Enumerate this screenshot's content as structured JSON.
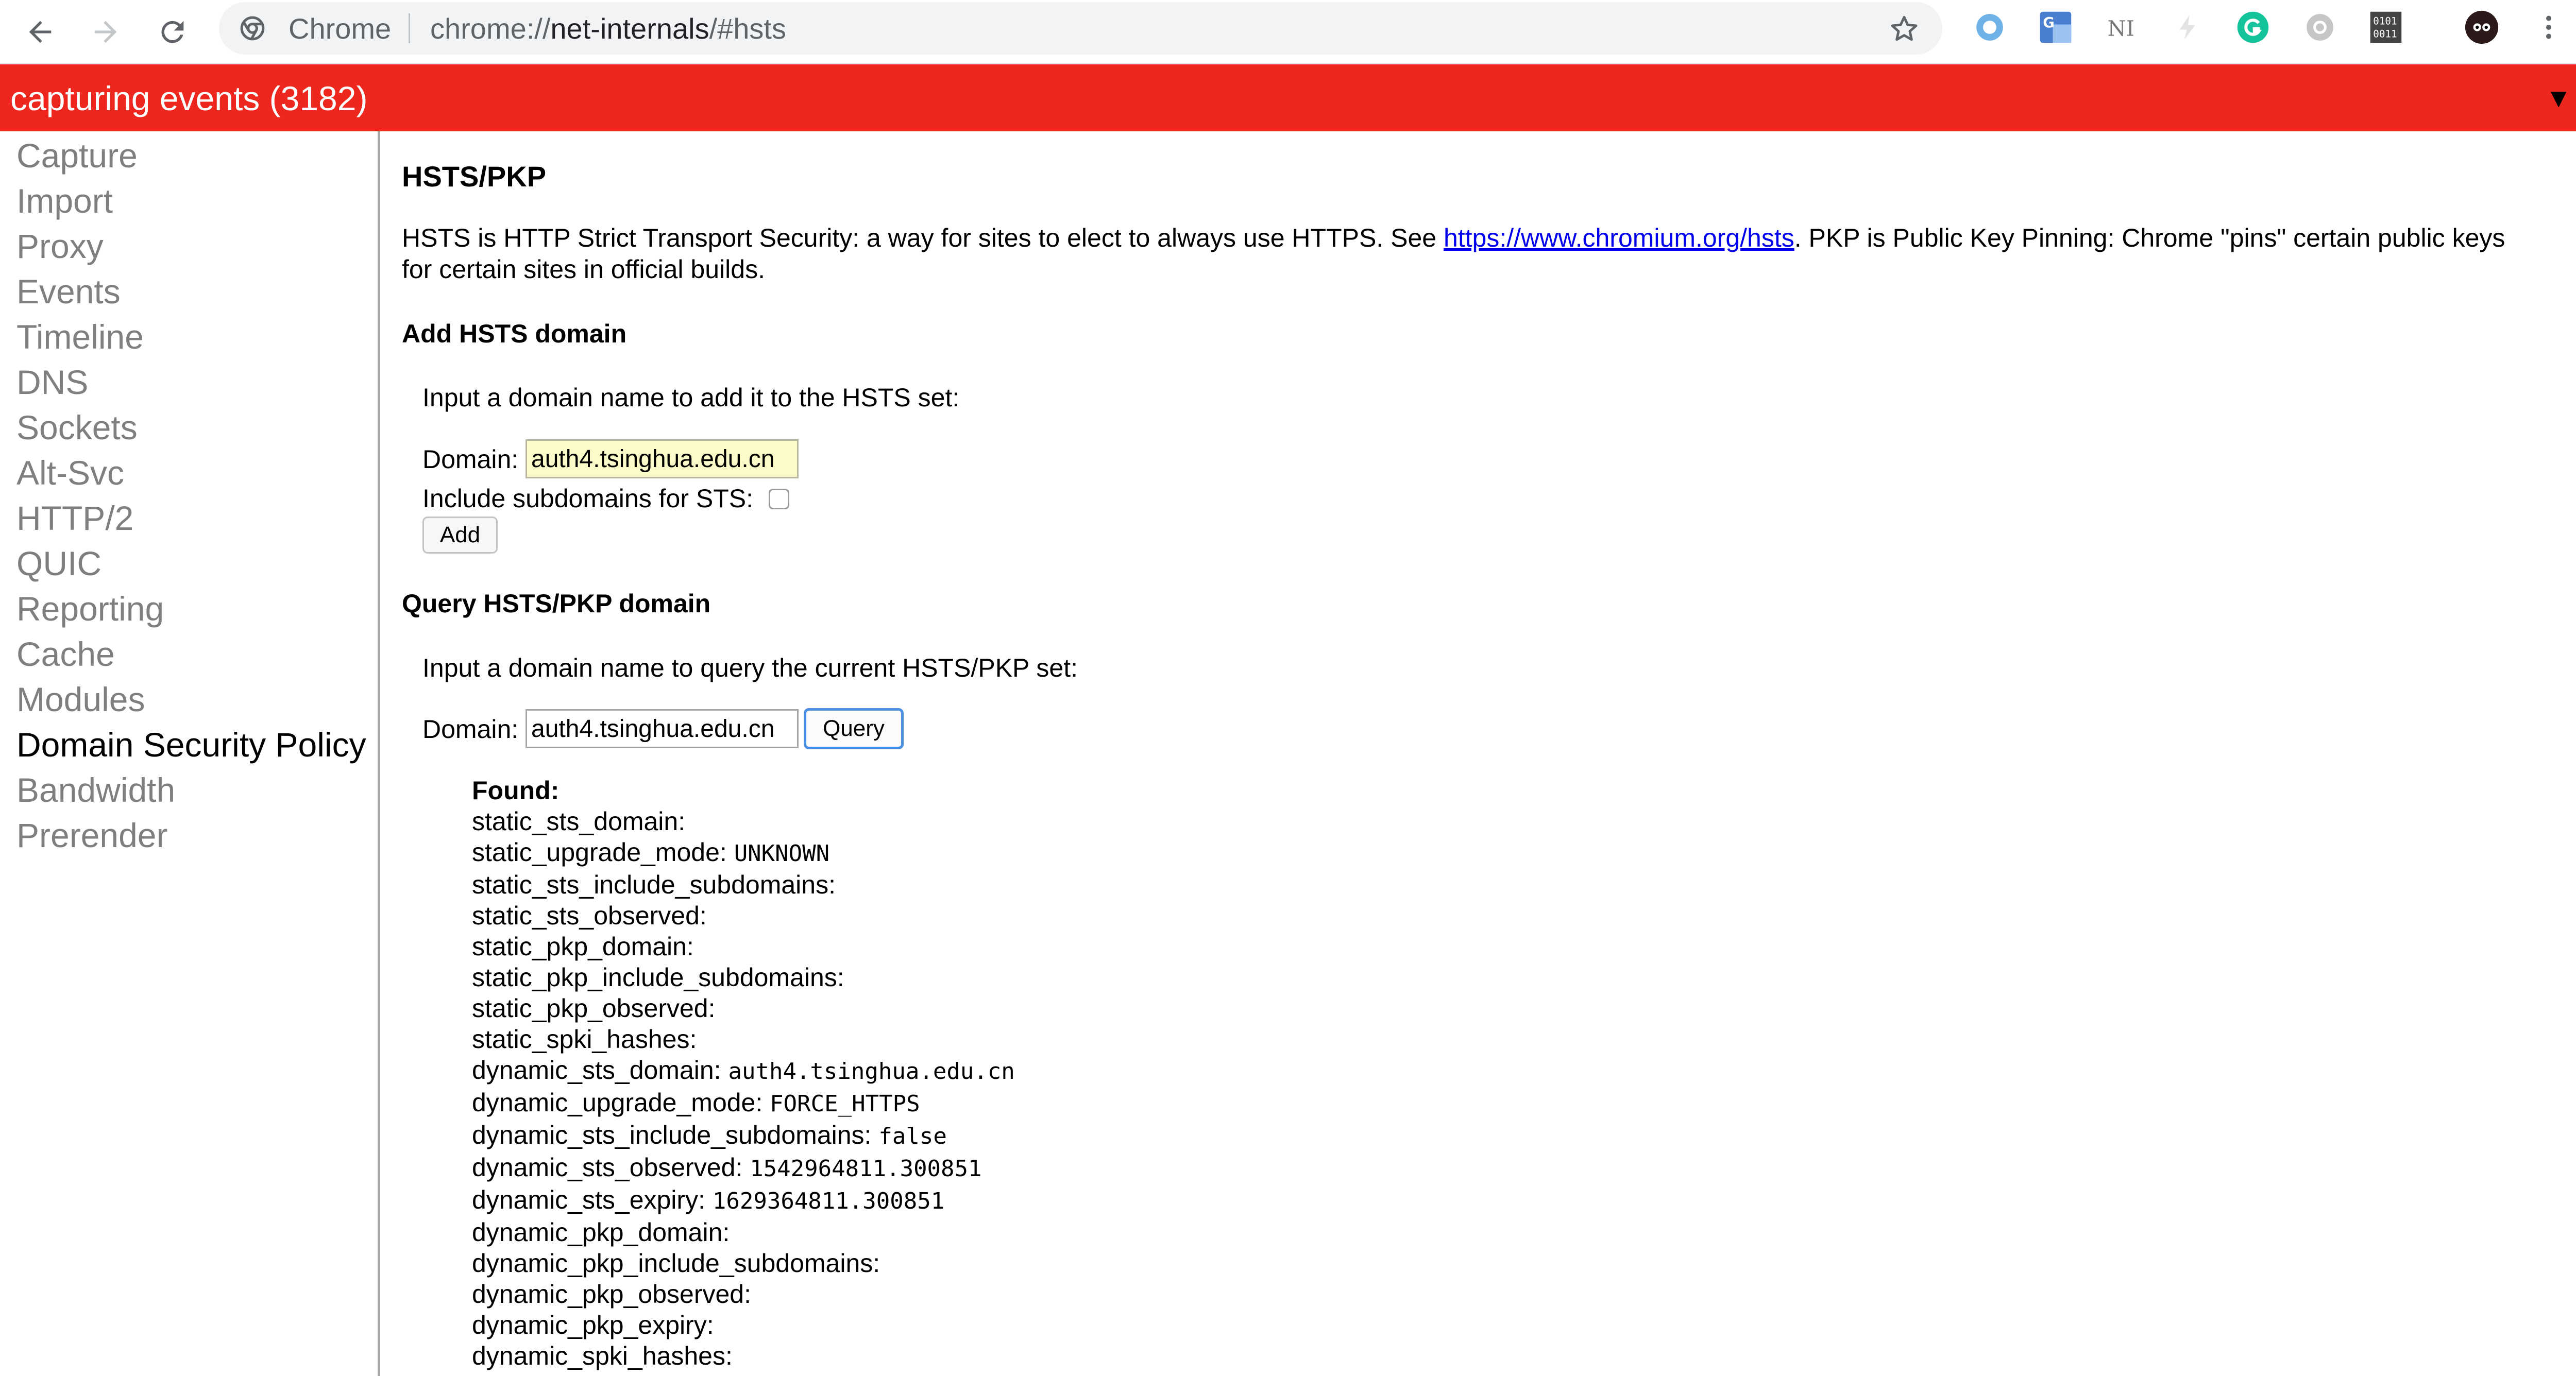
{
  "browser": {
    "back_icon": "arrow-left-icon",
    "forward_icon": "arrow-right-icon",
    "reload_icon": "reload-icon",
    "site_label": "Chrome",
    "url_scheme": "chrome://",
    "url_host": "net-internals",
    "url_path": "/#hsts",
    "bookmark_icon": "star-icon",
    "extensions": [
      "circle-extension-icon",
      "translate-extension-icon",
      "ni-extension-icon",
      "bolt-extension-icon",
      "grammarly-extension-icon",
      "gear-extension-icon",
      "binary-extension-icon",
      "avatar-icon",
      "menu-dots-icon"
    ],
    "ext_binary_text": "0101 0011",
    "ext_ni_text": "NI"
  },
  "capture_bar": {
    "text": "capturing events (3182)",
    "arrow": "▼",
    "color": "#ed271e"
  },
  "sidebar": {
    "items": [
      {
        "label": "Capture"
      },
      {
        "label": "Import"
      },
      {
        "label": "Proxy"
      },
      {
        "label": "Events"
      },
      {
        "label": "Timeline"
      },
      {
        "label": "DNS"
      },
      {
        "label": "Sockets"
      },
      {
        "label": "Alt-Svc"
      },
      {
        "label": "HTTP/2"
      },
      {
        "label": "QUIC"
      },
      {
        "label": "Reporting"
      },
      {
        "label": "Cache"
      },
      {
        "label": "Modules"
      },
      {
        "label": "Domain Security Policy",
        "active": true
      },
      {
        "label": "Bandwidth"
      },
      {
        "label": "Prerender"
      }
    ]
  },
  "main": {
    "title": "HSTS/PKP",
    "desc_part1": "HSTS is HTTP Strict Transport Security: a way for sites to elect to always use HTTPS. See ",
    "desc_link": "https://www.chromium.org/hsts",
    "desc_part2": ". PKP is Public Key Pinning: Chrome \"pins\" certain public keys",
    "desc_line2": "for certain sites in official builds.",
    "add": {
      "heading": "Add HSTS domain",
      "instruction": "Input a domain name to add it to the HSTS set:",
      "domain_label": "Domain:",
      "domain_value": "auth4.tsinghua.edu.cn",
      "subdomains_label": "Include subdomains for STS:",
      "subdomains_checked": false,
      "button": "Add"
    },
    "query": {
      "heading": "Query HSTS/PKP domain",
      "instruction": "Input a domain name to query the current HSTS/PKP set:",
      "domain_label": "Domain:",
      "domain_value": "auth4.tsinghua.edu.cn",
      "button": "Query"
    },
    "result": {
      "found_label": "Found:",
      "fields": [
        {
          "key": "static_sts_domain:",
          "value": ""
        },
        {
          "key": "static_upgrade_mode:",
          "value": "UNKNOWN"
        },
        {
          "key": "static_sts_include_subdomains:",
          "value": ""
        },
        {
          "key": "static_sts_observed:",
          "value": ""
        },
        {
          "key": "static_pkp_domain:",
          "value": ""
        },
        {
          "key": "static_pkp_include_subdomains:",
          "value": ""
        },
        {
          "key": "static_pkp_observed:",
          "value": ""
        },
        {
          "key": "static_spki_hashes:",
          "value": ""
        },
        {
          "key": "dynamic_sts_domain:",
          "value": "auth4.tsinghua.edu.cn"
        },
        {
          "key": "dynamic_upgrade_mode:",
          "value": "FORCE_HTTPS"
        },
        {
          "key": "dynamic_sts_include_subdomains:",
          "value": "false"
        },
        {
          "key": "dynamic_sts_observed:",
          "value": "1542964811.300851"
        },
        {
          "key": "dynamic_sts_expiry:",
          "value": "1629364811.300851"
        },
        {
          "key": "dynamic_pkp_domain:",
          "value": ""
        },
        {
          "key": "dynamic_pkp_include_subdomains:",
          "value": ""
        },
        {
          "key": "dynamic_pkp_observed:",
          "value": ""
        },
        {
          "key": "dynamic_pkp_expiry:",
          "value": ""
        },
        {
          "key": "dynamic_spki_hashes:",
          "value": ""
        }
      ]
    }
  }
}
